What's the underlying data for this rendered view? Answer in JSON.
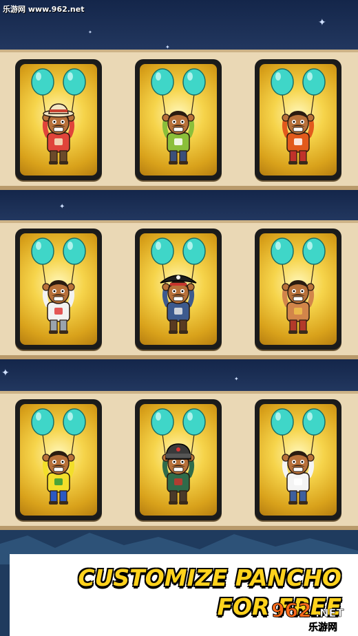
{
  "watermark": "乐游网 www.962.net",
  "caption": {
    "line1": "CUSTOMIZE PANCHO",
    "line2": "FOR FREE"
  },
  "logo": {
    "main": "962",
    "sub": "乐游网",
    "suffix": ".NET"
  },
  "colors": {
    "sky": "#1c2e52",
    "shelf": "#ead8b5",
    "balloon": "#3fd6c8",
    "card_frame": "#1b1b1b",
    "caption": "#ffd21c"
  },
  "costumes": [
    {
      "name": "tourist",
      "hat": "safari",
      "shirt": "#e0443a",
      "pants": "#6b4a2b",
      "accent": "#f4e9c4"
    },
    {
      "name": "peace",
      "hat": "none",
      "shirt": "#8bbf3a",
      "pants": "#3b4f7a",
      "accent": "#ffffff"
    },
    {
      "name": "basketball",
      "hat": "none",
      "shirt": "#e25a1c",
      "pants": "#c0322a",
      "accent": "#ffffff"
    },
    {
      "name": "doctor",
      "hat": "none",
      "shirt": "#f2f2f2",
      "pants": "#9aa3ad",
      "accent": "#e23b3b"
    },
    {
      "name": "pirate",
      "hat": "pirate",
      "shirt": "#3d5a8e",
      "pants": "#5a3b22",
      "accent": "#e8e8e8"
    },
    {
      "name": "native",
      "hat": "none",
      "shirt": "#d2854a",
      "pants": "#b33a2a",
      "accent": "#f0c04a"
    },
    {
      "name": "football",
      "hat": "none",
      "shirt": "#f3df2a",
      "pants": "#2b58c2",
      "accent": "#2e9b3a"
    },
    {
      "name": "winter",
      "hat": "ushanka",
      "shirt": "#2f6b4a",
      "pants": "#4a3a2a",
      "accent": "#c7352d"
    },
    {
      "name": "tanktop",
      "hat": "none",
      "shirt": "#f4f4f4",
      "pants": "#3e5f9e",
      "accent": "#ffffff"
    }
  ]
}
